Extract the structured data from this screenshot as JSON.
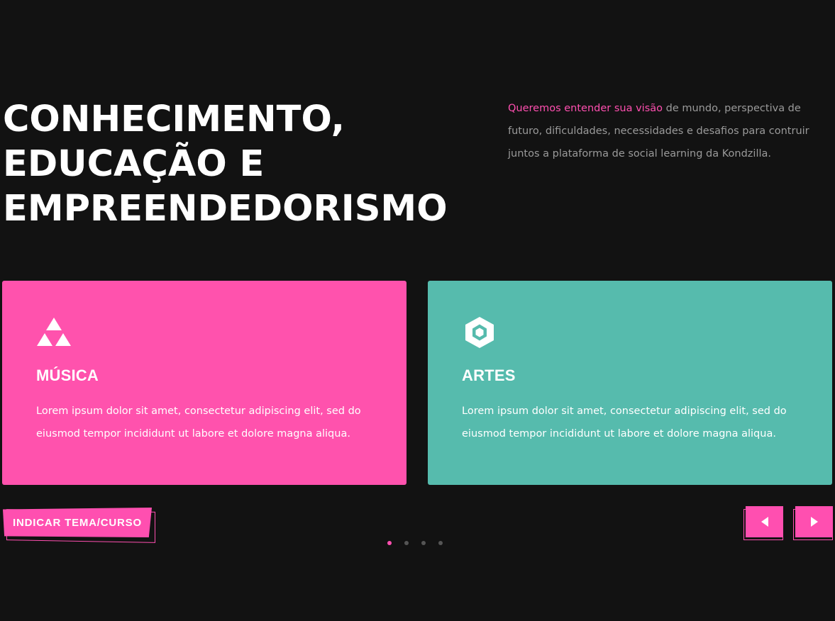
{
  "hero": {
    "title_lines": [
      "CONHECIMENTO,",
      "EDUCAÇÃO E",
      "EMPREENDEDORISMO"
    ]
  },
  "intro": {
    "highlight": "Queremos entender sua visão",
    "text": " de mundo, perspectiva de futuro, dificuldades, necessidades e desafios para contruir juntos a plataforma de social learning da Kondzilla."
  },
  "cards": [
    {
      "icon": "triforce-icon",
      "title": "MÚSICA",
      "text": "Lorem ipsum dolor sit amet, consectetur adipiscing elit, sed do eiusmod tempor incididunt ut labore et dolore magna aliqua.",
      "color": "#ff52ad"
    },
    {
      "icon": "hexagon-icon",
      "title": "ARTES",
      "text": "Lorem ipsum dolor sit amet, consectetur adipiscing elit, sed do eiusmod tempor incididunt ut labore et dolore magna aliqua.",
      "color": "#56bbad"
    }
  ],
  "cta": {
    "label": "INDICAR TEMA/CURSO"
  },
  "carousel": {
    "dot_count": 4,
    "active_dot": 1,
    "prev_icon": "arrow-left-icon",
    "next_icon": "arrow-right-icon"
  },
  "colors": {
    "background": "#121212",
    "accent": "#ff4fb0",
    "teal": "#56bbad",
    "muted_text": "#9a9a9a"
  }
}
